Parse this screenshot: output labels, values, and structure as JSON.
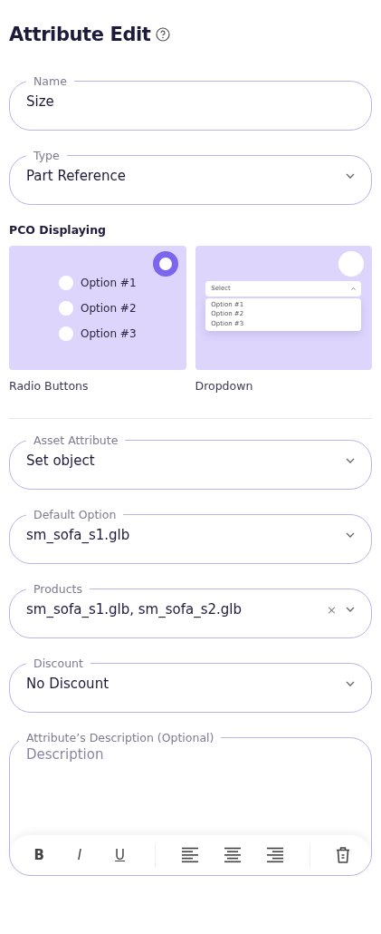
{
  "title": "Attribute Edit",
  "top_fields": [
    {
      "label": "Name",
      "kind": "text",
      "value": "Size"
    },
    {
      "label": "Type",
      "kind": "select",
      "value": "Part Reference"
    }
  ],
  "display": {
    "label": "PCO Displaying",
    "options": [
      {
        "kind": "radio",
        "caption": "Radio Buttons",
        "selected": true,
        "items": [
          "Option #1",
          "Option #2",
          "Option #3"
        ]
      },
      {
        "kind": "dropdown",
        "caption": "Dropdown",
        "selected": false,
        "select": "Select",
        "items": [
          "Option #1",
          "Option #2",
          "Option #3"
        ]
      }
    ]
  },
  "fields": [
    {
      "label": "Asset Attribute",
      "kind": "select",
      "value": "Set object"
    },
    {
      "label": "Default Option",
      "kind": "select",
      "value": "sm_sofa_s1.glb"
    },
    {
      "label": "Products",
      "kind": "multiselect",
      "value": "sm_sofa_s1.glb, sm_sofa_s2.glb",
      "clear": "×"
    },
    {
      "label": "Discount",
      "kind": "select",
      "value": "No Discount"
    }
  ],
  "description": {
    "label": "Attribute’s Description (Optional)",
    "placeholder": "Description",
    "toolbar": [
      {
        "kind": "bold",
        "label": "B"
      },
      {
        "kind": "italic",
        "label": "I"
      },
      {
        "kind": "underline",
        "label": "U"
      },
      {
        "kind": "sep"
      },
      {
        "kind": "align-left"
      },
      {
        "kind": "align-center"
      },
      {
        "kind": "align-right"
      },
      {
        "kind": "sep"
      },
      {
        "kind": "delete"
      }
    ]
  }
}
